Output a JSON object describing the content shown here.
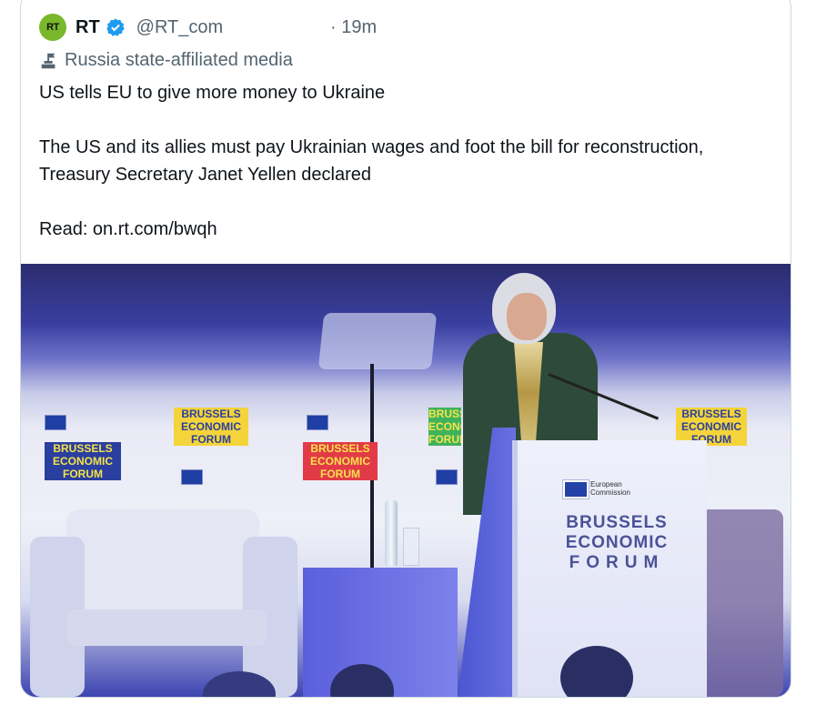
{
  "tweet": {
    "avatar_text": "RT",
    "display_name": "RT",
    "handle": "@RT_com",
    "time": "· 19m",
    "affiliation": "Russia state-affiliated media",
    "text_lines": [
      "US tells EU to give more money to Ukraine",
      "The US and its allies must pay Ukrainian wages and foot the bill for reconstruction, Treasury Secretary Janet Yellen declared",
      "Read: on.rt.com/bwqh"
    ]
  },
  "photo": {
    "banner_line1": "BRUSSELS",
    "banner_line2": "ECONOMIC",
    "banner_line3": "FORUM",
    "podium_ec_line1": "European",
    "podium_ec_line2": "Commission"
  },
  "colors": {
    "avatar_bg": "#78b82a",
    "verified": "#1d9bf0",
    "secondary_text": "#536471"
  }
}
